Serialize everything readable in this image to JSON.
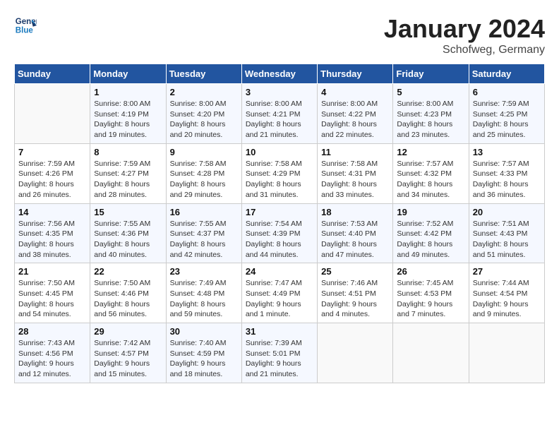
{
  "header": {
    "logo_line1": "General",
    "logo_line2": "Blue",
    "month": "January 2024",
    "location": "Schofweg, Germany"
  },
  "weekdays": [
    "Sunday",
    "Monday",
    "Tuesday",
    "Wednesday",
    "Thursday",
    "Friday",
    "Saturday"
  ],
  "weeks": [
    [
      {
        "num": "",
        "info": ""
      },
      {
        "num": "1",
        "info": "Sunrise: 8:00 AM\nSunset: 4:19 PM\nDaylight: 8 hours\nand 19 minutes."
      },
      {
        "num": "2",
        "info": "Sunrise: 8:00 AM\nSunset: 4:20 PM\nDaylight: 8 hours\nand 20 minutes."
      },
      {
        "num": "3",
        "info": "Sunrise: 8:00 AM\nSunset: 4:21 PM\nDaylight: 8 hours\nand 21 minutes."
      },
      {
        "num": "4",
        "info": "Sunrise: 8:00 AM\nSunset: 4:22 PM\nDaylight: 8 hours\nand 22 minutes."
      },
      {
        "num": "5",
        "info": "Sunrise: 8:00 AM\nSunset: 4:23 PM\nDaylight: 8 hours\nand 23 minutes."
      },
      {
        "num": "6",
        "info": "Sunrise: 7:59 AM\nSunset: 4:25 PM\nDaylight: 8 hours\nand 25 minutes."
      }
    ],
    [
      {
        "num": "7",
        "info": "Sunrise: 7:59 AM\nSunset: 4:26 PM\nDaylight: 8 hours\nand 26 minutes."
      },
      {
        "num": "8",
        "info": "Sunrise: 7:59 AM\nSunset: 4:27 PM\nDaylight: 8 hours\nand 28 minutes."
      },
      {
        "num": "9",
        "info": "Sunrise: 7:58 AM\nSunset: 4:28 PM\nDaylight: 8 hours\nand 29 minutes."
      },
      {
        "num": "10",
        "info": "Sunrise: 7:58 AM\nSunset: 4:29 PM\nDaylight: 8 hours\nand 31 minutes."
      },
      {
        "num": "11",
        "info": "Sunrise: 7:58 AM\nSunset: 4:31 PM\nDaylight: 8 hours\nand 33 minutes."
      },
      {
        "num": "12",
        "info": "Sunrise: 7:57 AM\nSunset: 4:32 PM\nDaylight: 8 hours\nand 34 minutes."
      },
      {
        "num": "13",
        "info": "Sunrise: 7:57 AM\nSunset: 4:33 PM\nDaylight: 8 hours\nand 36 minutes."
      }
    ],
    [
      {
        "num": "14",
        "info": "Sunrise: 7:56 AM\nSunset: 4:35 PM\nDaylight: 8 hours\nand 38 minutes."
      },
      {
        "num": "15",
        "info": "Sunrise: 7:55 AM\nSunset: 4:36 PM\nDaylight: 8 hours\nand 40 minutes."
      },
      {
        "num": "16",
        "info": "Sunrise: 7:55 AM\nSunset: 4:37 PM\nDaylight: 8 hours\nand 42 minutes."
      },
      {
        "num": "17",
        "info": "Sunrise: 7:54 AM\nSunset: 4:39 PM\nDaylight: 8 hours\nand 44 minutes."
      },
      {
        "num": "18",
        "info": "Sunrise: 7:53 AM\nSunset: 4:40 PM\nDaylight: 8 hours\nand 47 minutes."
      },
      {
        "num": "19",
        "info": "Sunrise: 7:52 AM\nSunset: 4:42 PM\nDaylight: 8 hours\nand 49 minutes."
      },
      {
        "num": "20",
        "info": "Sunrise: 7:51 AM\nSunset: 4:43 PM\nDaylight: 8 hours\nand 51 minutes."
      }
    ],
    [
      {
        "num": "21",
        "info": "Sunrise: 7:50 AM\nSunset: 4:45 PM\nDaylight: 8 hours\nand 54 minutes."
      },
      {
        "num": "22",
        "info": "Sunrise: 7:50 AM\nSunset: 4:46 PM\nDaylight: 8 hours\nand 56 minutes."
      },
      {
        "num": "23",
        "info": "Sunrise: 7:49 AM\nSunset: 4:48 PM\nDaylight: 8 hours\nand 59 minutes."
      },
      {
        "num": "24",
        "info": "Sunrise: 7:47 AM\nSunset: 4:49 PM\nDaylight: 9 hours\nand 1 minute."
      },
      {
        "num": "25",
        "info": "Sunrise: 7:46 AM\nSunset: 4:51 PM\nDaylight: 9 hours\nand 4 minutes."
      },
      {
        "num": "26",
        "info": "Sunrise: 7:45 AM\nSunset: 4:53 PM\nDaylight: 9 hours\nand 7 minutes."
      },
      {
        "num": "27",
        "info": "Sunrise: 7:44 AM\nSunset: 4:54 PM\nDaylight: 9 hours\nand 9 minutes."
      }
    ],
    [
      {
        "num": "28",
        "info": "Sunrise: 7:43 AM\nSunset: 4:56 PM\nDaylight: 9 hours\nand 12 minutes."
      },
      {
        "num": "29",
        "info": "Sunrise: 7:42 AM\nSunset: 4:57 PM\nDaylight: 9 hours\nand 15 minutes."
      },
      {
        "num": "30",
        "info": "Sunrise: 7:40 AM\nSunset: 4:59 PM\nDaylight: 9 hours\nand 18 minutes."
      },
      {
        "num": "31",
        "info": "Sunrise: 7:39 AM\nSunset: 5:01 PM\nDaylight: 9 hours\nand 21 minutes."
      },
      {
        "num": "",
        "info": ""
      },
      {
        "num": "",
        "info": ""
      },
      {
        "num": "",
        "info": ""
      }
    ]
  ]
}
